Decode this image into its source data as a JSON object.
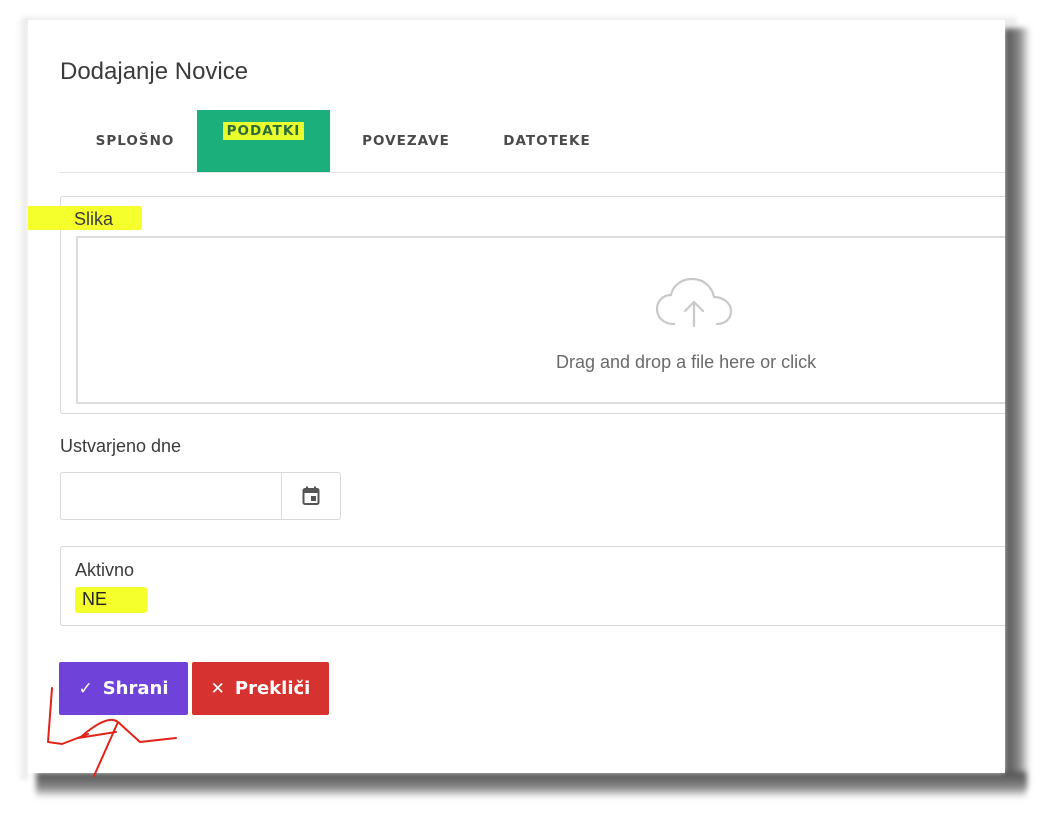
{
  "page": {
    "title": "Dodajanje Novice"
  },
  "tabs": [
    {
      "label": "SPLOŠNO",
      "active": false
    },
    {
      "label": "PODATKI",
      "active": true
    },
    {
      "label": "POVEZAVE",
      "active": false
    },
    {
      "label": "DATOTEKE",
      "active": false
    }
  ],
  "image_field": {
    "label": "Slika",
    "dropzone_text": "Drag and drop a file here or click",
    "icon": "cloud-upload-icon"
  },
  "date_field": {
    "label": "Ustvarjeno dne",
    "value": "",
    "icon": "calendar-icon"
  },
  "active_field": {
    "label": "Aktivno",
    "value": "NE"
  },
  "actions": {
    "save_label": "Shrani",
    "save_icon": "check-icon",
    "cancel_label": "Prekliči",
    "cancel_icon": "close-icon"
  },
  "colors": {
    "active_tab": "#1aaf7b",
    "highlight": "#f4ff2c",
    "save_button": "#6f42d9",
    "cancel_button": "#d6322f",
    "annotation": "#e0231b"
  }
}
